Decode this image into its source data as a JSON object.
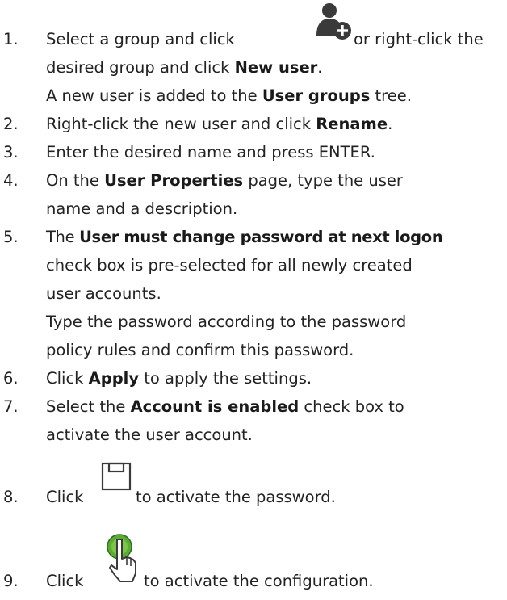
{
  "steps": [
    {
      "number": "1.",
      "lines": [
        {
          "a": "Select a group and click",
          "b": "or right-click the"
        },
        {
          "a": "desired group and click ",
          "bold": "New user",
          "c": "."
        },
        {
          "a": "A new user is added to the ",
          "bold": "User groups",
          "c": " tree."
        }
      ]
    },
    {
      "number": "2.",
      "lines": [
        {
          "a": "Right-click the new user and click ",
          "bold": "Rename",
          "c": "."
        }
      ]
    },
    {
      "number": "3.",
      "lines": [
        {
          "a": "Enter the desired name and press ENTER."
        }
      ]
    },
    {
      "number": "4.",
      "lines": [
        {
          "a": "On the ",
          "bold": "User Properties",
          "c": " page, type the user"
        },
        {
          "a": "name and a description."
        }
      ]
    },
    {
      "number": "5.",
      "lines": [
        {
          "a": "The ",
          "bold": "User must change password at next logon"
        },
        {
          "a": "check box is pre-selected for all newly created"
        },
        {
          "a": "user accounts."
        },
        {
          "a": "Type the password according to the password"
        },
        {
          "a": "policy rules and confirm this password."
        }
      ]
    },
    {
      "number": "6.",
      "lines": [
        {
          "a": "Click ",
          "bold": "Apply",
          "c": " to apply the settings."
        }
      ]
    },
    {
      "number": "7.",
      "lines": [
        {
          "a": "Select the ",
          "bold": "Account is enabled",
          "c": " check box to"
        },
        {
          "a": "activate the user account."
        }
      ]
    },
    {
      "number": "8.",
      "lines": [
        {
          "a": "Click",
          "b": "to activate the password."
        }
      ]
    },
    {
      "number": "9.",
      "lines": [
        {
          "a": "Click",
          "b": "to activate the configuration."
        }
      ]
    }
  ],
  "icons": {
    "new_user": "new-user-icon",
    "save": "save-icon",
    "activate": "activate-configuration-icon"
  }
}
